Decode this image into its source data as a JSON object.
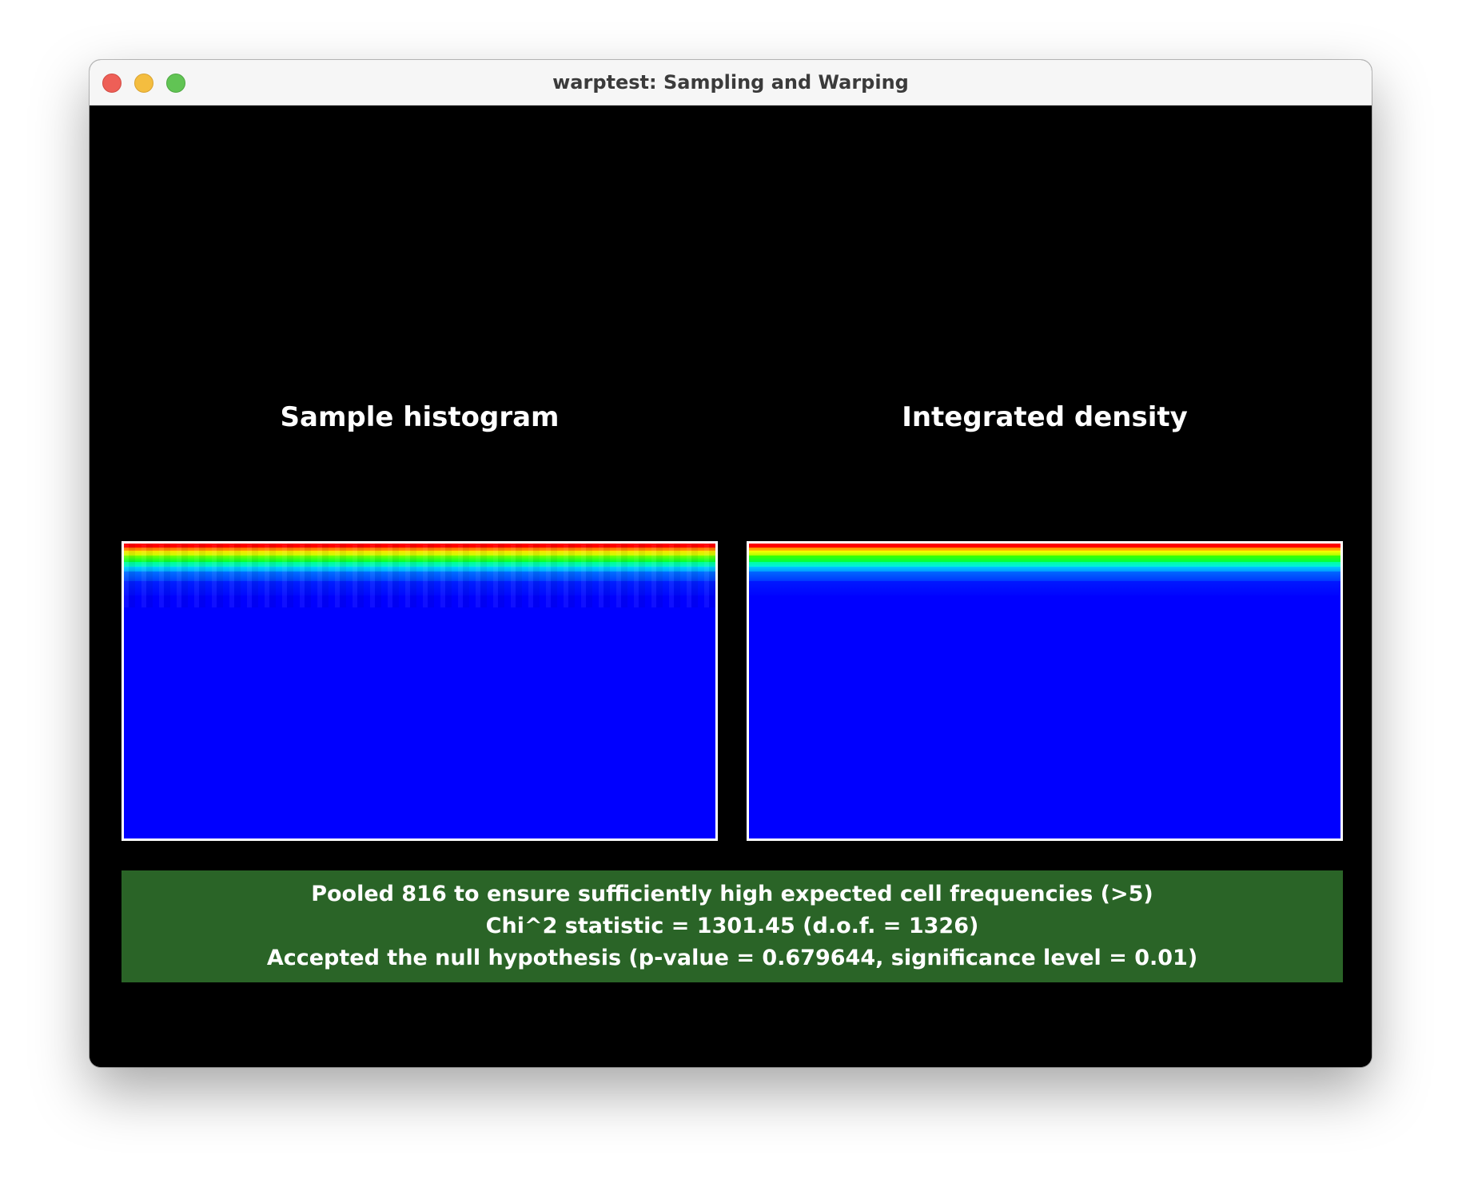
{
  "window": {
    "title": "warptest: Sampling and Warping"
  },
  "panels": {
    "left_title": "Sample histogram",
    "right_title": "Integrated density"
  },
  "status": {
    "lines": [
      "Pooled 816 to ensure sufficiently high expected cell frequencies (>5)",
      "Chi^2 statistic = 1301.45 (d.o.f. = 1326)",
      "Accepted the null hypothesis (p-value = 0.679644, significance level = 0.01)"
    ],
    "background_color": "#2a6427"
  },
  "colors": {
    "canvas_background": "#000000",
    "low_density": "#0000ff",
    "high_density": "#ff0000"
  }
}
